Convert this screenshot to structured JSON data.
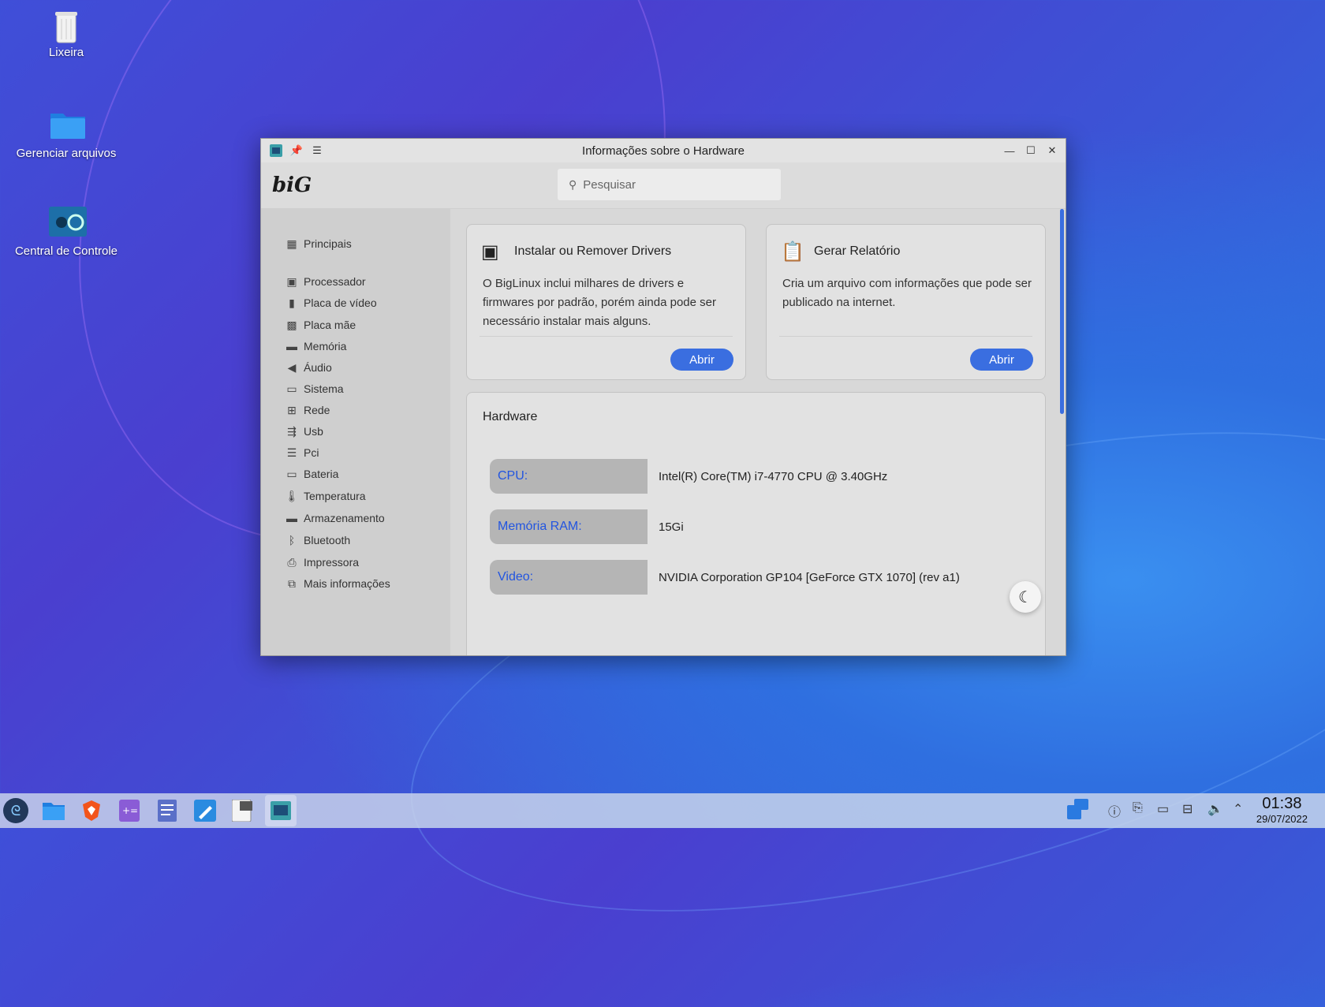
{
  "desktop": {
    "icons": [
      {
        "label": "Lixeira",
        "icon": "trash-icon"
      },
      {
        "label": "Gerenciar arquivos",
        "icon": "folder-icon"
      },
      {
        "label": "Central de Controle",
        "icon": "control-center-icon"
      }
    ]
  },
  "window": {
    "title": "Informações sobre o Hardware",
    "logo_text": "biG",
    "search": {
      "placeholder": "Pesquisar"
    }
  },
  "sidebar": {
    "items": [
      {
        "label": "Principais",
        "icon": "grid-icon"
      },
      {
        "label": "Processador",
        "icon": "cpu-icon"
      },
      {
        "label": "Placa de vídeo",
        "icon": "gpu-icon"
      },
      {
        "label": "Placa mãe",
        "icon": "motherboard-icon"
      },
      {
        "label": "Memória",
        "icon": "memory-icon"
      },
      {
        "label": "Áudio",
        "icon": "speaker-icon"
      },
      {
        "label": "Sistema",
        "icon": "monitor-icon"
      },
      {
        "label": "Rede",
        "icon": "network-icon"
      },
      {
        "label": "Usb",
        "icon": "usb-icon"
      },
      {
        "label": "Pci",
        "icon": "pci-icon"
      },
      {
        "label": "Bateria",
        "icon": "battery-icon"
      },
      {
        "label": "Temperatura",
        "icon": "thermometer-icon"
      },
      {
        "label": "Armazenamento",
        "icon": "storage-icon"
      },
      {
        "label": "Bluetooth",
        "icon": "bluetooth-icon"
      },
      {
        "label": "Impressora",
        "icon": "printer-icon"
      },
      {
        "label": "Mais informações",
        "icon": "more-info-icon"
      }
    ]
  },
  "cards": {
    "drivers": {
      "title": "Instalar ou Remover Drivers",
      "body": "O BigLinux inclui milhares de drivers e firmwares por padrão, porém ainda pode ser necessário instalar mais alguns.",
      "button": "Abrir"
    },
    "report": {
      "title": "Gerar Relatório",
      "body": "Cria um arquivo com informações que pode ser publicado na internet.",
      "button": "Abrir"
    }
  },
  "hardware": {
    "title": "Hardware",
    "rows": [
      {
        "key": "CPU:",
        "value": "Intel(R) Core(TM) i7-4770 CPU @ 3.40GHz"
      },
      {
        "key": "Memória RAM:",
        "value": "15Gi"
      },
      {
        "key": "Video:",
        "value": "NVIDIA Corporation GP104 [GeForce GTX 1070] (rev a1)"
      }
    ]
  },
  "taskbar": {
    "time": "01:38",
    "date": "29/07/2022",
    "apps": [
      "start-menu-icon",
      "files-icon",
      "brave-icon",
      "calculator-icon",
      "documents-icon",
      "text-editor-icon",
      "big-store-icon",
      "hardware-info-icon"
    ]
  },
  "colors": {
    "accent": "#3a6ee0",
    "key_text": "#2255e0"
  }
}
